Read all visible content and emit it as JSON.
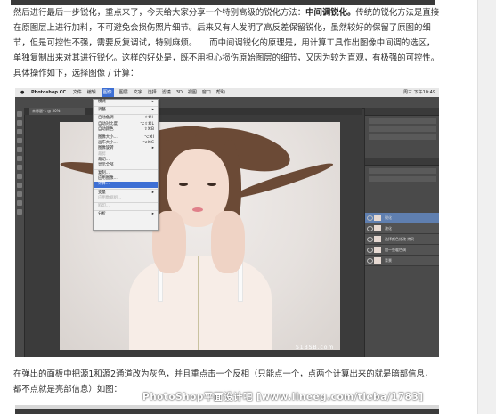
{
  "article": {
    "paragraph1_part1": "然后进行最后一步锐化，重点来了，今天给大家分享一个特别高级的锐化方法：",
    "paragraph1_bold": "中间调锐化。",
    "paragraph1_part2": "传统的锐化方法是直接在原图层上进行加料，不可避免会损伤照片细节。后来又有人发明了高反差保留锐化，虽然较好的保留了原图的细节，但是可控性不强，需要反复调试，特别麻烦。　　而中间调锐化的原理是，用计算工具作出图像中间调的选区，单独复制出来对其进行锐化。这样的好处是，既不用担心损伤原始图层的细节，又因为较为直观，有极强的可控性。　　具体操作如下，选择图像 / 计算：",
    "paragraph2": "在弹出的面板中把源1和源2通道改为灰色，并且重点击一个反相（只能点一个，点两个计算出来的就是暗部信息，都不点就是亮部信息）如图："
  },
  "screenshot": {
    "menubar": {
      "app": "Photoshop CC",
      "items": [
        "文件",
        "编辑",
        "图像",
        "图层",
        "文字",
        "选择",
        "滤镜",
        "3D",
        "视图",
        "窗口",
        "帮助"
      ],
      "active": "图像",
      "clock": "周三 下午10:49"
    },
    "doc_tab": "未标题-1 @ 50%",
    "image_menu": [
      {
        "label": "模式",
        "shortcut": "▸",
        "state": "normal"
      },
      {
        "sep": true
      },
      {
        "label": "调整",
        "shortcut": "▸",
        "state": "normal"
      },
      {
        "sep": true
      },
      {
        "label": "自动色调",
        "shortcut": "⇧⌘L",
        "state": "normal"
      },
      {
        "label": "自动对比度",
        "shortcut": "⌥⇧⌘L",
        "state": "normal"
      },
      {
        "label": "自动颜色",
        "shortcut": "⇧⌘B",
        "state": "normal"
      },
      {
        "sep": true
      },
      {
        "label": "图像大小...",
        "shortcut": "⌥⌘I",
        "state": "normal"
      },
      {
        "label": "画布大小...",
        "shortcut": "⌥⌘C",
        "state": "normal"
      },
      {
        "label": "图像旋转",
        "shortcut": "▸",
        "state": "normal"
      },
      {
        "label": "裁剪",
        "shortcut": "",
        "state": "disabled"
      },
      {
        "label": "裁切...",
        "shortcut": "",
        "state": "normal"
      },
      {
        "label": "显示全部",
        "shortcut": "",
        "state": "normal"
      },
      {
        "sep": true
      },
      {
        "label": "复制...",
        "shortcut": "",
        "state": "normal"
      },
      {
        "label": "应用图像...",
        "shortcut": "",
        "state": "normal"
      },
      {
        "label": "计算...",
        "shortcut": "",
        "state": "highlight"
      },
      {
        "sep": true
      },
      {
        "label": "变量",
        "shortcut": "▸",
        "state": "normal"
      },
      {
        "label": "应用数据组...",
        "shortcut": "",
        "state": "disabled"
      },
      {
        "sep": true
      },
      {
        "label": "陷印...",
        "shortcut": "",
        "state": "disabled"
      },
      {
        "sep": true
      },
      {
        "label": "分析",
        "shortcut": "▸",
        "state": "normal"
      }
    ],
    "layers": [
      {
        "name": "锐化",
        "selected": true
      },
      {
        "name": "液化",
        "selected": false
      },
      {
        "name": "选择颜色修改 拷贝",
        "selected": false
      },
      {
        "name": "加一些暖色调",
        "selected": false
      },
      {
        "name": "背景",
        "selected": false
      }
    ],
    "canvas_watermark": "S1BSB.com"
  },
  "watermark": "PhotoShop平面设计吧 [www.lineeg.com/tieba/1783]"
}
